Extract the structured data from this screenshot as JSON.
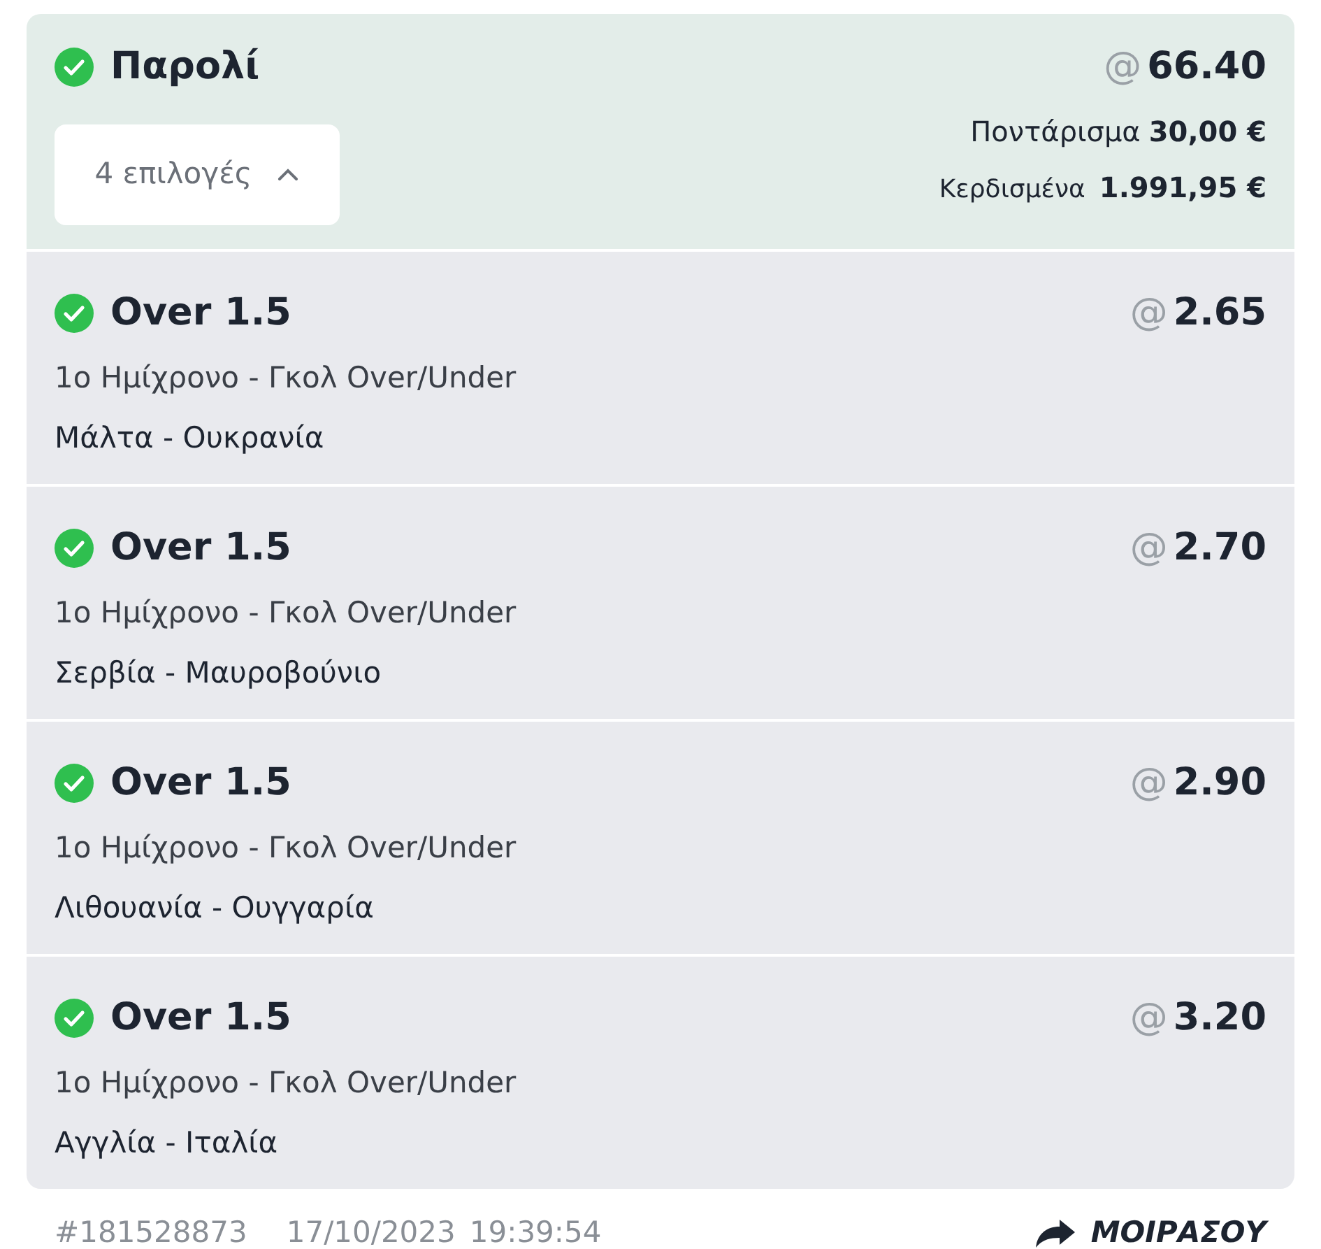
{
  "bet": {
    "title": "Παρολί",
    "won": true,
    "odds_prefix": "@",
    "odds": "66.40",
    "selections_toggle": {
      "label": "4 επιλογές",
      "expanded": true
    },
    "stake_label": "Ποντάρισμα",
    "stake": "30,00 €",
    "winnings_label": "Κερδισμένα",
    "winnings": "1.991,95 €"
  },
  "selections": [
    {
      "pick": "Over 1.5",
      "won": true,
      "odds_prefix": "@",
      "odds": "2.65",
      "market": "1ο Ημίχρονο - Γκολ Over/Under",
      "match": "Μάλτα - Ουκρανία"
    },
    {
      "pick": "Over 1.5",
      "won": true,
      "odds_prefix": "@",
      "odds": "2.70",
      "market": "1ο Ημίχρονο - Γκολ Over/Under",
      "match": "Σερβία - Μαυροβούνιο"
    },
    {
      "pick": "Over 1.5",
      "won": true,
      "odds_prefix": "@",
      "odds": "2.90",
      "market": "1ο Ημίχρονο - Γκολ Over/Under",
      "match": "Λιθουανία - Ουγγαρία"
    },
    {
      "pick": "Over 1.5",
      "won": true,
      "odds_prefix": "@",
      "odds": "3.20",
      "market": "1ο Ημίχρονο - Γκολ Over/Under",
      "match": "Αγγλία - Ιταλία"
    }
  ],
  "footer": {
    "bet_id": "#181528873",
    "date": "17/10/2023",
    "time": "19:39:54",
    "share_label": "ΜΟΙΡΑΣΟΥ"
  }
}
